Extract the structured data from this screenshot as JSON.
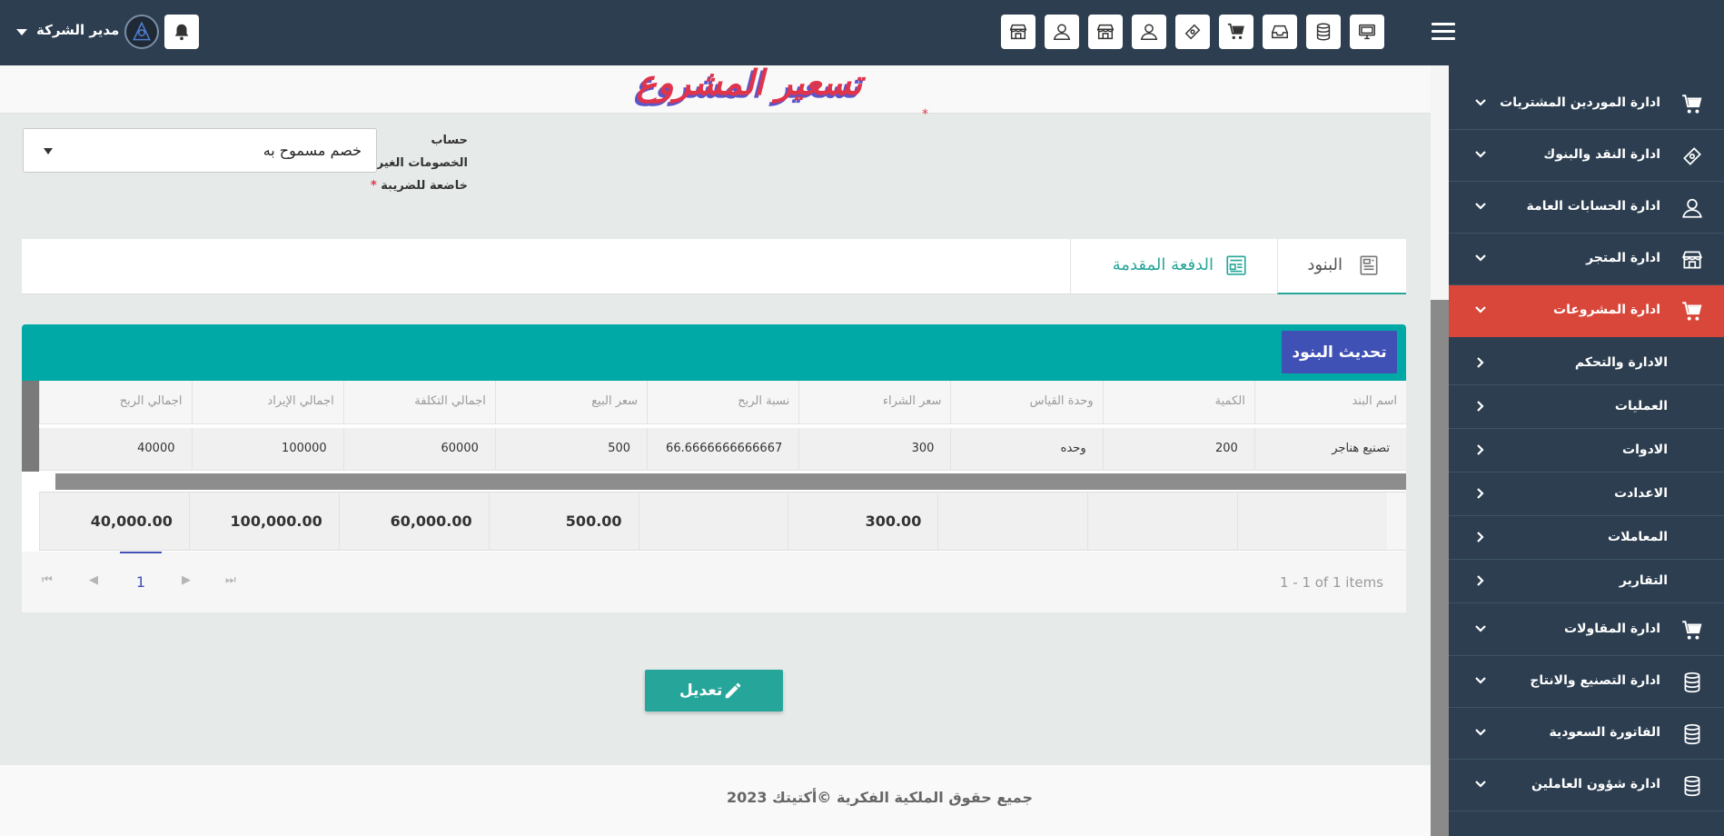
{
  "header": {
    "user_name": "مدير الشركة",
    "icons": [
      "monitor-icon",
      "database-icon",
      "inbox-icon",
      "cart-icon",
      "money-icon",
      "user-icon",
      "store-icon",
      "user-icon",
      "store-icon"
    ]
  },
  "page": {
    "title": "تسعير المشروع"
  },
  "form": {
    "discount_label": "حساب الخصومات الغير خاضعة للضريبة",
    "discount_required": "*",
    "discount_value": "خصم مسموح به"
  },
  "tabs": [
    {
      "label": "البنود",
      "active": true
    },
    {
      "label": "الدفعة المقدمة",
      "active": false
    }
  ],
  "grid": {
    "refresh_label": "تحديث البنود",
    "columns": [
      "اسم البند",
      "الكمية",
      "وحدة القياس",
      "سعر الشراء",
      "نسبة الربح",
      "سعر البيع",
      "اجمالي التكلفة",
      "اجمالي الإيراد",
      "اجمالي الربح"
    ],
    "rows": [
      [
        "تصنيع هناجر",
        "200",
        "وحده",
        "300",
        "66.6666666666667",
        "500",
        "60000",
        "100000",
        "40000"
      ]
    ],
    "totals": [
      "",
      "",
      "",
      "300.00",
      "",
      "500.00",
      "60,000.00",
      "100,000.00",
      "40,000.00"
    ],
    "pager": {
      "current_page": "1",
      "info": "1 - 1 of 1 items"
    }
  },
  "actions": {
    "edit_label": "تعديل"
  },
  "footer": {
    "text": "جميع حقوق الملكية الفكرية ©أكتيتك 2023"
  },
  "sidebar": {
    "items": [
      {
        "label": "ادارة الموردين المشتريات",
        "icon": "cart-icon"
      },
      {
        "label": "ادارة النقد والبنوك",
        "icon": "money-icon"
      },
      {
        "label": "ادارة الحسابات العامة",
        "icon": "user-icon"
      },
      {
        "label": "ادارة المتجر",
        "icon": "store-icon"
      },
      {
        "label": "ادارة المشروعات",
        "icon": "cart-icon",
        "active": true
      }
    ],
    "sub_items": [
      {
        "label": "الادارة والتحكم"
      },
      {
        "label": "العمليات"
      },
      {
        "label": "الادوات"
      },
      {
        "label": "الاعدادت"
      },
      {
        "label": "المعاملات"
      },
      {
        "label": "التقارير"
      }
    ],
    "items_after": [
      {
        "label": "ادارة المقاولات",
        "icon": "cart-icon"
      },
      {
        "label": "ادارة التصنيع والانتاج",
        "icon": "database-icon"
      },
      {
        "label": "الفاتورة السعودية",
        "icon": "database-icon"
      },
      {
        "label": "ادارة شؤون العاملين",
        "icon": "database-icon"
      }
    ]
  },
  "colors": {
    "topbar": "#2c3e50",
    "active_menu": "#d9473a",
    "teal": "#00a9a6",
    "primary": "#3f51b5",
    "edit_button": "#26a69a"
  }
}
